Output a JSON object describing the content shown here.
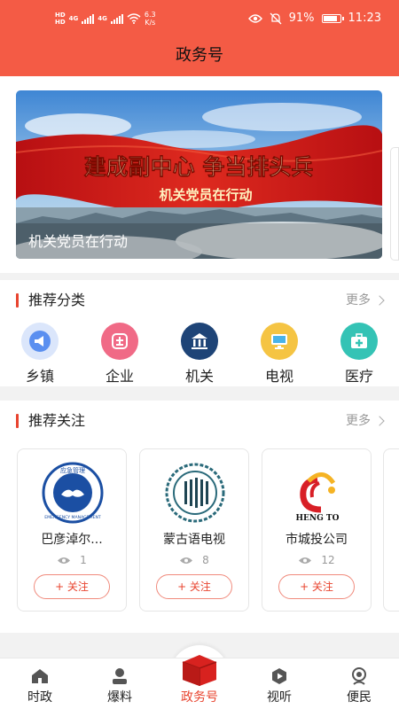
{
  "status": {
    "left_hd_top": "HD",
    "left_hd_bottom": "HD",
    "net1": "4G",
    "net2": "4G",
    "speed_value": "6.3",
    "speed_unit": "K/s",
    "battery": "91%",
    "battery_level": 0.91,
    "time": "11:23"
  },
  "header": {
    "title": "政务号"
  },
  "banner": {
    "headline": "建成副中心 争当排头兵",
    "subline": "机关党员在行动",
    "caption": "机关党员在行动"
  },
  "categories": {
    "title": "推荐分类",
    "more": "更多",
    "items": [
      {
        "label": "乡镇",
        "icon": "megaphone-icon",
        "color": "#5a8ff0"
      },
      {
        "label": "企业",
        "icon": "enterprise-icon",
        "color": "#f06a86"
      },
      {
        "label": "机关",
        "icon": "government-building-icon",
        "color": "#1e4477"
      },
      {
        "label": "电视",
        "icon": "television-icon",
        "color": "#f5c443"
      },
      {
        "label": "医疗",
        "icon": "medical-kit-icon",
        "color": "#34c3b5"
      }
    ]
  },
  "follows": {
    "title": "推荐关注",
    "more": "更多",
    "items": [
      {
        "name": "巴彦淖尔...",
        "count": "1",
        "follow": "+ 关注",
        "logo": "emergency-management-logo",
        "logo_text": "EMERGENCY MANAGEMENT",
        "logo_top": "应急管理"
      },
      {
        "name": "蒙古语电视",
        "count": "8",
        "follow": "+ 关注",
        "logo": "mongolian-tv-logo"
      },
      {
        "name": "市城投公司",
        "count": "12",
        "follow": "+ 关注",
        "logo": "chengtou-logo",
        "logo_text": "HENG TO"
      }
    ]
  },
  "nav": {
    "items": [
      {
        "label": "时政",
        "icon": "home-icon"
      },
      {
        "label": "爆料",
        "icon": "reporter-icon"
      },
      {
        "label": "政务号",
        "icon": "gov-box-icon"
      },
      {
        "label": "视听",
        "icon": "play-icon"
      },
      {
        "label": "便民",
        "icon": "service-icon"
      }
    ]
  },
  "colors": {
    "brand": "#f45b45",
    "accent": "#e8442f"
  }
}
